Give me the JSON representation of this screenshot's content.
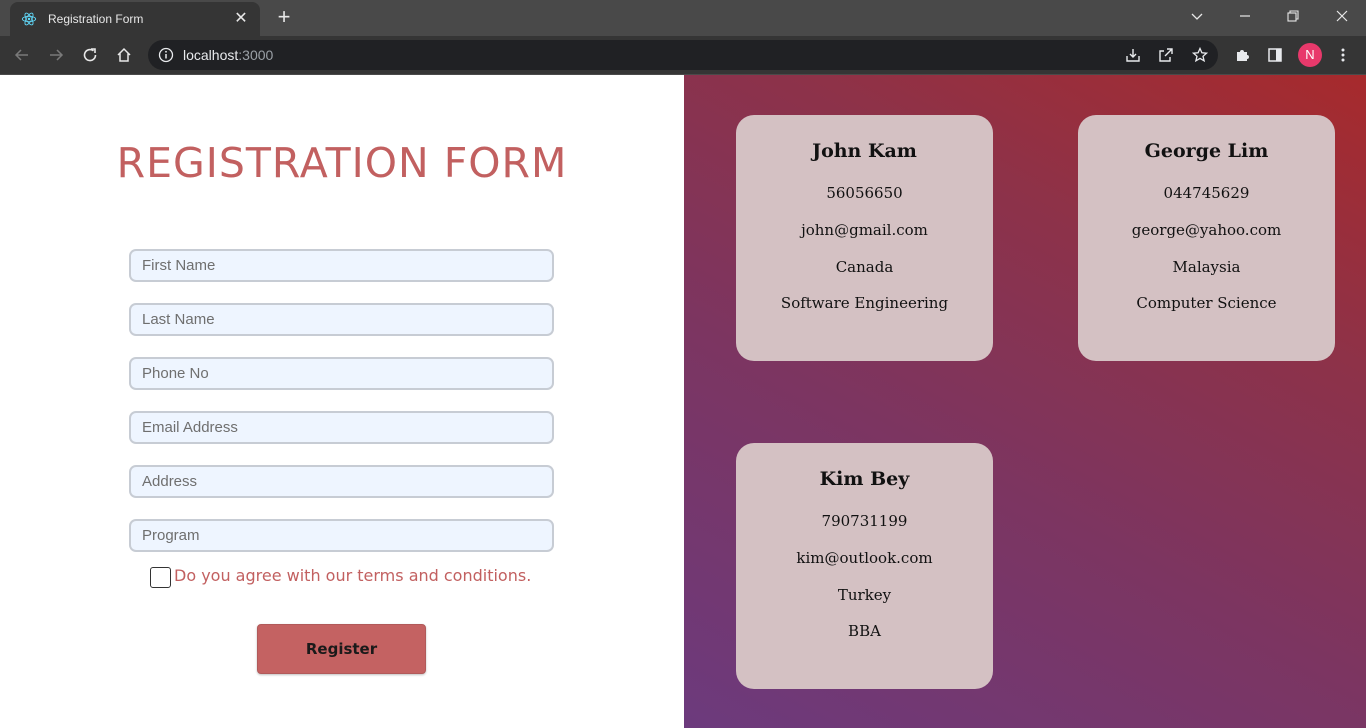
{
  "browser": {
    "tab_title": "Registration Form",
    "url_host": "localhost",
    "url_port": ":3000",
    "profile_initial": "N"
  },
  "form": {
    "title": "REGISTRATION FORM",
    "placeholders": {
      "first_name": "First Name",
      "last_name": "Last Name",
      "phone": "Phone No",
      "email": "Email Address",
      "address": "Address",
      "program": "Program"
    },
    "terms_label": "Do you agree with our terms and conditions.",
    "terms_checked": false,
    "register_label": "Register"
  },
  "cards": [
    {
      "name": "John Kam",
      "phone": "56056650",
      "email": "john@gmail.com",
      "country": "Canada",
      "program": "Software Engineering"
    },
    {
      "name": "George Lim",
      "phone": "044745629",
      "email": "george@yahoo.com",
      "country": "Malaysia",
      "program": "Computer Science"
    },
    {
      "name": "Kim Bey",
      "phone": "790731199",
      "email": "kim@outlook.com",
      "country": "Turkey",
      "program": "BBA"
    }
  ],
  "colors": {
    "accent": "#c26060",
    "card_bg": "#d4c1c3",
    "input_bg": "#eef5ff"
  }
}
